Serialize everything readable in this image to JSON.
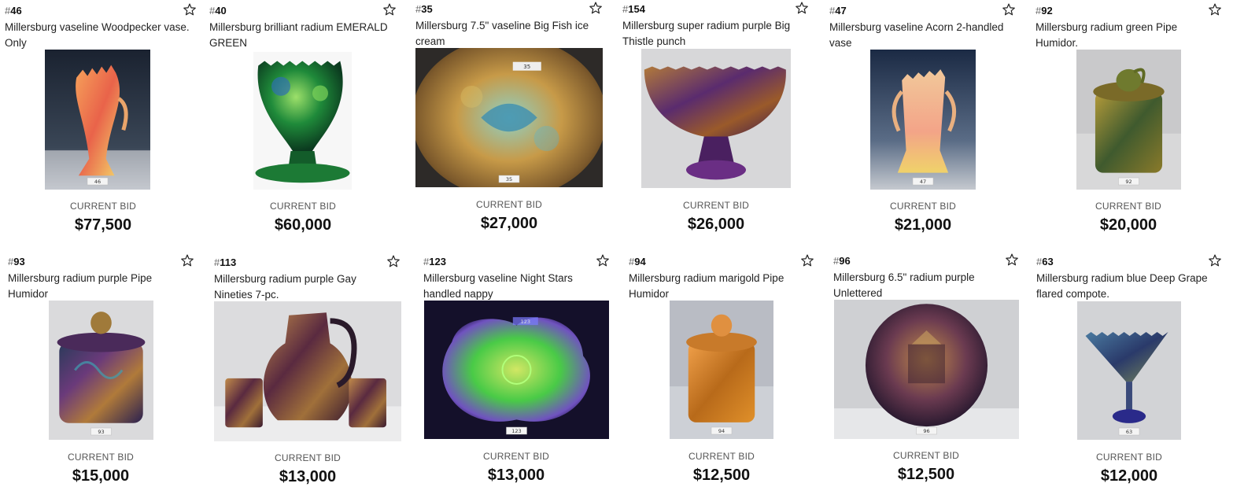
{
  "lots": [
    {
      "hash": "#",
      "number": "46",
      "title": "Millersburg vaseline Woodpecker vase. Only",
      "bid_label": "CURRENT BID",
      "bid": "$77,500",
      "tag": "46",
      "icon": "star-outline-icon"
    },
    {
      "hash": "#",
      "number": "40",
      "title": "Millersburg brilliant radium EMERALD GREEN",
      "bid_label": "CURRENT BID",
      "bid": "$60,000",
      "icon": "star-outline-icon"
    },
    {
      "hash": "#",
      "number": "35",
      "title": "Millersburg 7.5\" vaseline Big Fish ice cream",
      "bid_label": "CURRENT BID",
      "bid": "$27,000",
      "tag": "35",
      "icon": "star-outline-icon"
    },
    {
      "hash": "#",
      "number": "154",
      "title": "Millersburg super radium purple Big Thistle punch",
      "bid_label": "CURRENT BID",
      "bid": "$26,000",
      "icon": "star-outline-icon"
    },
    {
      "hash": "#",
      "number": "47",
      "title": "Millersburg vaseline Acorn 2-handled vase",
      "bid_label": "CURRENT BID",
      "bid": "$21,000",
      "tag": "47",
      "icon": "star-outline-icon"
    },
    {
      "hash": "#",
      "number": "92",
      "title": "Millersburg radium green Pipe Humidor.",
      "bid_label": "CURRENT BID",
      "bid": "$20,000",
      "tag": "92",
      "icon": "star-outline-icon"
    },
    {
      "hash": "#",
      "number": "93",
      "title": "Millersburg radium purple Pipe Humidor",
      "bid_label": "CURRENT BID",
      "bid": "$15,000",
      "tag": "93",
      "icon": "star-outline-icon"
    },
    {
      "hash": "#",
      "number": "113",
      "title": "Millersburg radium purple Gay Nineties 7-pc.",
      "bid_label": "CURRENT BID",
      "bid": "$13,000",
      "icon": "star-outline-icon"
    },
    {
      "hash": "#",
      "number": "123",
      "title": "Millersburg vaseline Night Stars handled nappy",
      "bid_label": "CURRENT BID",
      "bid": "$13,000",
      "tag": "123",
      "icon": "star-outline-icon"
    },
    {
      "hash": "#",
      "number": "94",
      "title": "Millersburg radium marigold Pipe Humidor",
      "bid_label": "CURRENT BID",
      "bid": "$12,500",
      "tag": "94",
      "icon": "star-outline-icon"
    },
    {
      "hash": "#",
      "number": "96",
      "title": "Millersburg 6.5\" radium purple Unlettered",
      "bid_label": "CURRENT BID",
      "bid": "$12,500",
      "tag": "96",
      "icon": "star-outline-icon"
    },
    {
      "hash": "#",
      "number": "63",
      "title": "Millersburg radium blue Deep Grape flared compote.",
      "bid_label": "CURRENT BID",
      "bid": "$12,000",
      "tag": "63",
      "icon": "star-outline-icon"
    }
  ],
  "colors": {
    "text": "#222222",
    "hash": "#666666",
    "label": "#555555",
    "star": "#222222"
  }
}
